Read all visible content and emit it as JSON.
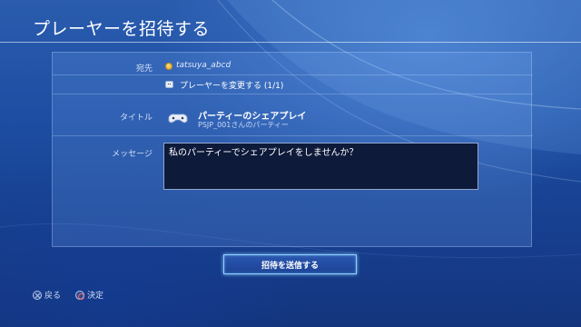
{
  "header": {
    "title": "プレーヤーを招待する"
  },
  "form": {
    "recipient_label": "宛先",
    "recipient_name": "tatsuya_abcd",
    "change_players_label": "プレーヤーを変更する (1/1)",
    "title_label": "タイトル",
    "party_title": "パーティーのシェアプレイ",
    "party_subtitle": "PSJP_001さんのパーティー",
    "message_label": "メッセージ",
    "message_text": "私のパーティーでシェアプレイをしませんか？"
  },
  "actions": {
    "send_label": "招待を送信する"
  },
  "footer": {
    "back_label": "戻る",
    "confirm_label": "決定"
  },
  "colors": {
    "background": "#1d4ea3",
    "panel": "#3a6cc0",
    "message_box": "#0d1a3a",
    "focus_glow": "#8fd0ff"
  },
  "icons": {
    "recipient": "coin-avatar-icon",
    "change_players": "face-icon",
    "party": "controller-handshake-icon",
    "back": "cross-button-icon",
    "confirm": "circle-button-icon"
  }
}
